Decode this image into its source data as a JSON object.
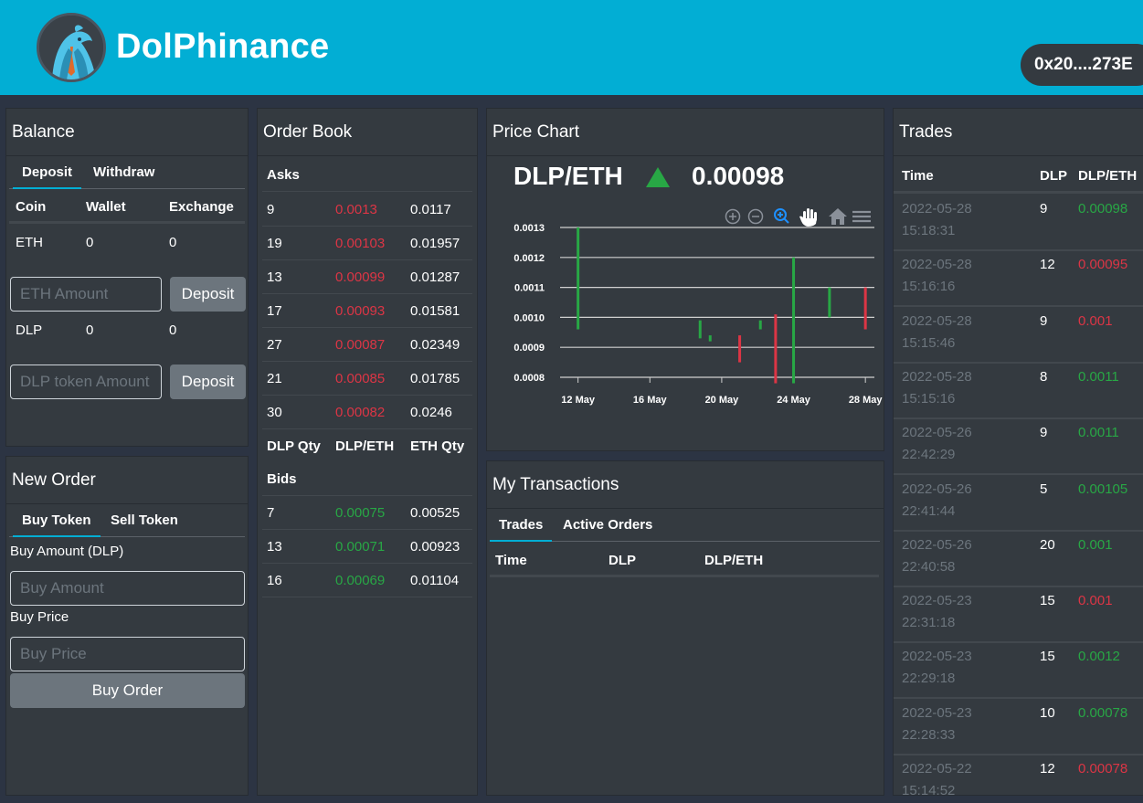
{
  "app": {
    "brand": "DolPhinance",
    "account": "0x20....273E"
  },
  "balance": {
    "title": "Balance",
    "tabs": [
      "Deposit",
      "Withdraw"
    ],
    "headers": [
      "Coin",
      "Wallet",
      "Exchange"
    ],
    "rows": [
      {
        "coin": "ETH",
        "wallet": "0",
        "exchange": "0",
        "placeholder": "ETH Amount",
        "button": "Deposit"
      },
      {
        "coin": "DLP",
        "wallet": "0",
        "exchange": "0",
        "placeholder": "DLP token Amount",
        "button": "Deposit"
      }
    ]
  },
  "new_order": {
    "title": "New Order",
    "tabs": [
      "Buy Token",
      "Sell Token"
    ],
    "amount_label": "Buy Amount (DLP)",
    "amount_placeholder": "Buy Amount",
    "price_label": "Buy Price",
    "price_placeholder": "Buy Price",
    "button": "Buy Order"
  },
  "order_book": {
    "title": "Order Book",
    "asks_label": "Asks",
    "bids_label": "Bids",
    "headers": [
      "DLP Qty",
      "DLP/ETH",
      "ETH Qty"
    ],
    "asks": [
      [
        "9",
        "0.0013",
        "0.0117"
      ],
      [
        "19",
        "0.00103",
        "0.01957"
      ],
      [
        "13",
        "0.00099",
        "0.01287"
      ],
      [
        "17",
        "0.00093",
        "0.01581"
      ],
      [
        "27",
        "0.00087",
        "0.02349"
      ],
      [
        "21",
        "0.00085",
        "0.01785"
      ],
      [
        "30",
        "0.00082",
        "0.0246"
      ]
    ],
    "bids": [
      [
        "7",
        "0.00075",
        "0.00525"
      ],
      [
        "13",
        "0.00071",
        "0.00923"
      ],
      [
        "16",
        "0.00069",
        "0.01104"
      ]
    ]
  },
  "price_chart": {
    "title": "Price Chart",
    "pair": "DLP/ETH",
    "last_price": "0.00098",
    "trend": "up",
    "colors": {
      "up": "#28a745",
      "down": "#dc3545"
    },
    "toolbar_icons": [
      "zoom-in-icon",
      "zoom-out-icon",
      "zoom-select-icon",
      "pan-hand-icon",
      "reset-home-icon",
      "menu-icon"
    ]
  },
  "chart_data": {
    "type": "candlestick",
    "title": "",
    "xlabel": "",
    "ylabel": "",
    "ylim": [
      0.0008,
      0.0013
    ],
    "xlim": [
      "2022-05-11",
      "2022-05-28"
    ],
    "x_ticks": [
      "12 May",
      "16 May",
      "20 May",
      "24 May",
      "28 May"
    ],
    "y_ticks": [
      "0.0008",
      "0.0009",
      "0.0010",
      "0.0011",
      "0.0012",
      "0.0013"
    ],
    "grid": true,
    "candles": [
      {
        "date": "2022-05-12",
        "open": 0.00096,
        "close": 0.0013,
        "high": 0.0013,
        "low": 0.00096,
        "dir": "up"
      },
      {
        "date": "2022-05-19",
        "open": 0.00093,
        "close": 0.00099,
        "high": 0.00099,
        "low": 0.00093,
        "dir": "up"
      },
      {
        "date": "2022-05-19",
        "open": 0.00092,
        "close": 0.00094,
        "high": 0.00094,
        "low": 0.00092,
        "dir": "up"
      },
      {
        "date": "2022-05-21",
        "open": 0.00094,
        "close": 0.00085,
        "high": 0.00094,
        "low": 0.00085,
        "dir": "down"
      },
      {
        "date": "2022-05-22",
        "open": 0.00096,
        "close": 0.00099,
        "high": 0.00099,
        "low": 0.00096,
        "dir": "up"
      },
      {
        "date": "2022-05-23",
        "open": 0.00101,
        "close": 0.00078,
        "high": 0.00101,
        "low": 0.00078,
        "dir": "down"
      },
      {
        "date": "2022-05-24",
        "open": 0.00078,
        "close": 0.0012,
        "high": 0.0012,
        "low": 0.00078,
        "dir": "up"
      },
      {
        "date": "2022-05-26",
        "open": 0.001,
        "close": 0.0011,
        "high": 0.0011,
        "low": 0.001,
        "dir": "up"
      },
      {
        "date": "2022-05-28",
        "open": 0.0011,
        "close": 0.00096,
        "high": 0.0011,
        "low": 0.00096,
        "dir": "down"
      }
    ]
  },
  "transactions": {
    "title": "My Transactions",
    "tabs": [
      "Trades",
      "Active Orders"
    ],
    "headers": [
      "Time",
      "DLP",
      "DLP/ETH"
    ]
  },
  "trades": {
    "title": "Trades",
    "headers": [
      "Time",
      "DLP",
      "DLP/ETH"
    ],
    "rows": [
      {
        "date": "2022-05-28",
        "time": "15:18:31",
        "dlp": "9",
        "price": "0.00098",
        "dir": "up"
      },
      {
        "date": "2022-05-28",
        "time": "15:16:16",
        "dlp": "12",
        "price": "0.00095",
        "dir": "down"
      },
      {
        "date": "2022-05-28",
        "time": "15:15:46",
        "dlp": "9",
        "price": "0.001",
        "dir": "down"
      },
      {
        "date": "2022-05-28",
        "time": "15:15:16",
        "dlp": "8",
        "price": "0.0011",
        "dir": "up"
      },
      {
        "date": "2022-05-26",
        "time": "22:42:29",
        "dlp": "9",
        "price": "0.0011",
        "dir": "up"
      },
      {
        "date": "2022-05-26",
        "time": "22:41:44",
        "dlp": "5",
        "price": "0.00105",
        "dir": "up"
      },
      {
        "date": "2022-05-26",
        "time": "22:40:58",
        "dlp": "20",
        "price": "0.001",
        "dir": "up"
      },
      {
        "date": "2022-05-23",
        "time": "22:31:18",
        "dlp": "15",
        "price": "0.001",
        "dir": "down"
      },
      {
        "date": "2022-05-23",
        "time": "22:29:18",
        "dlp": "15",
        "price": "0.0012",
        "dir": "up"
      },
      {
        "date": "2022-05-23",
        "time": "22:28:33",
        "dlp": "10",
        "price": "0.00078",
        "dir": "up"
      },
      {
        "date": "2022-05-22",
        "time": "15:14:52",
        "dlp": "12",
        "price": "0.00078",
        "dir": "down"
      }
    ]
  }
}
